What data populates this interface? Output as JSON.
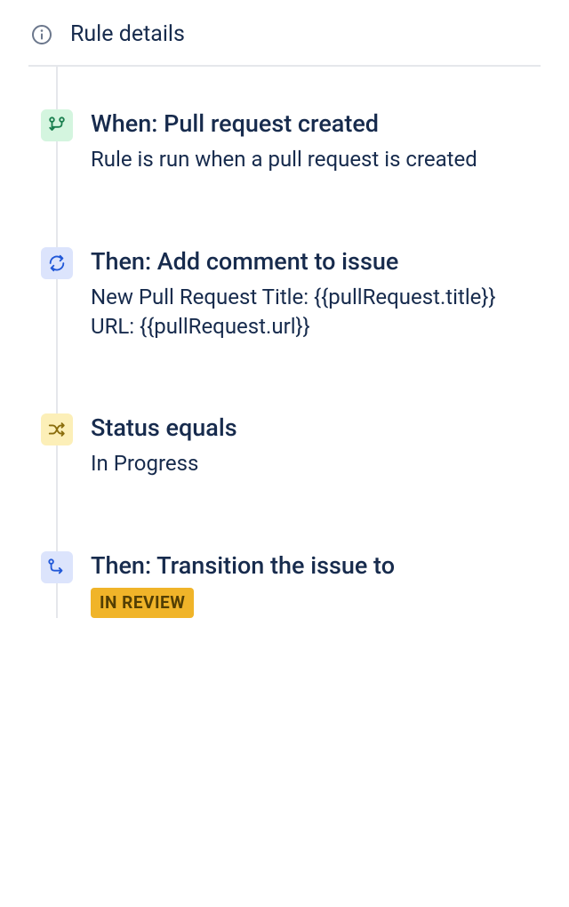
{
  "header": {
    "title": "Rule details"
  },
  "steps": [
    {
      "icon": "branch-icon",
      "iconClass": "trigger",
      "title": "When: Pull request created",
      "description": "Rule is run when a pull request is created"
    },
    {
      "icon": "cycle-icon",
      "iconClass": "action",
      "title": "Then: Add comment to issue",
      "description": "New Pull Request Title: {{pullRequest.title}} URL: {{pullRequest.url}}"
    },
    {
      "icon": "shuffle-icon",
      "iconClass": "condition",
      "title": "Status equals",
      "description": "In Progress"
    },
    {
      "icon": "flow-icon",
      "iconClass": "action",
      "title": "Then: Transition the issue to",
      "badge": "IN REVIEW"
    }
  ]
}
